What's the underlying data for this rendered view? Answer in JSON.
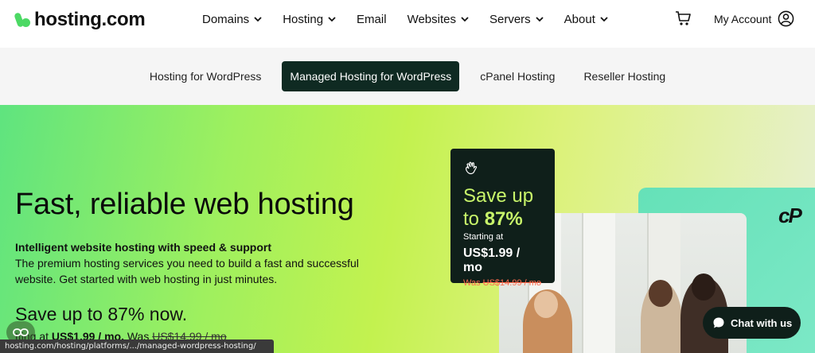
{
  "logo": {
    "text": "hosting.com"
  },
  "nav": {
    "items": [
      {
        "label": "Domains",
        "dropdown": true
      },
      {
        "label": "Hosting",
        "dropdown": true
      },
      {
        "label": "Email",
        "dropdown": false
      },
      {
        "label": "Websites",
        "dropdown": true
      },
      {
        "label": "Servers",
        "dropdown": true
      },
      {
        "label": "About",
        "dropdown": true
      }
    ],
    "cart_icon": "cart-icon",
    "account_label": "My Account",
    "account_icon": "user-circle-icon"
  },
  "subnav": {
    "tabs": [
      {
        "label": "Hosting for WordPress",
        "active": false
      },
      {
        "label": "Managed Hosting for WordPress",
        "active": true
      },
      {
        "label": "cPanel Hosting",
        "active": false
      },
      {
        "label": "Reseller Hosting",
        "active": false
      }
    ]
  },
  "hero": {
    "title": "Fast, reliable web hosting",
    "subtitle": "Intelligent website hosting with speed & support",
    "description": "The premium hosting services you need to build a fast and successful website. Get started with web hosting in just minutes.",
    "save_text": "Save up to 87% now.",
    "price_prefix": "tting at",
    "price": "US$1.99 / mo.",
    "was_prefix": "Was",
    "was_price": "US$14.99 / mo"
  },
  "promo": {
    "icon": "waving-hand-icon",
    "save_line1": "Save up",
    "save_line2_prefix": "to ",
    "save_percent": "87%",
    "starting": "Starting at",
    "price": "US$1.99 / mo",
    "was_prefix": "Was",
    "was_price": "US$14.99 / mo"
  },
  "cpanel_logo": "cP",
  "chat": {
    "label": "Chat with us",
    "icon": "chat-bubble-icon"
  },
  "status_bar": {
    "url": "hosting.com/hosting/platforms/.../managed-wordpress-hosting/"
  },
  "colors": {
    "accent_dark": "#0f2a22",
    "promo_green": "#c8f56a",
    "was_red": "#ff6a4d"
  }
}
